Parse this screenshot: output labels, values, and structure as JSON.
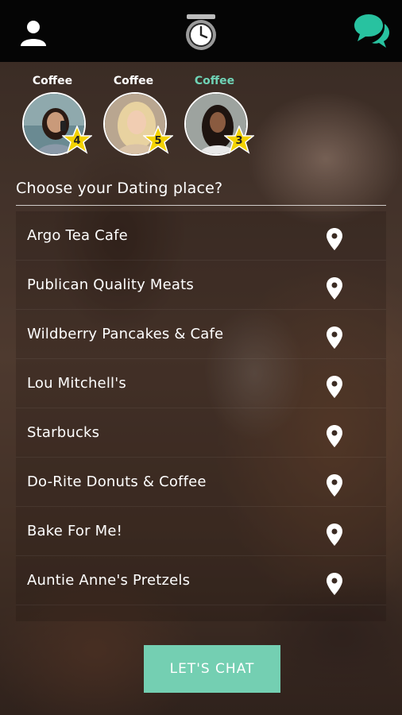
{
  "topbar": {
    "user_icon": "user-icon",
    "timer_icon": "stopwatch-icon",
    "chat_icon": "chat-bubbles-icon",
    "accent_color": "#28c2a0"
  },
  "profiles": [
    {
      "label": "Coffee",
      "rating": "4",
      "active": false
    },
    {
      "label": "Coffee",
      "rating": "5",
      "active": false
    },
    {
      "label": "Coffee",
      "rating": "3",
      "active": true
    }
  ],
  "question": "Choose your Dating place?",
  "places": [
    {
      "name": "Argo Tea Cafe"
    },
    {
      "name": "Publican Quality Meats"
    },
    {
      "name": "Wildberry Pancakes & Cafe"
    },
    {
      "name": "Lou Mitchell's"
    },
    {
      "name": "Starbucks"
    },
    {
      "name": "Do-Rite Donuts & Coffee"
    },
    {
      "name": "Bake For Me!"
    },
    {
      "name": "Auntie Anne's Pretzels"
    }
  ],
  "cta": {
    "label": "LET'S CHAT",
    "color": "#74cfb2"
  },
  "colors": {
    "active_label": "#6fd3b6",
    "star": "#f3d200"
  }
}
